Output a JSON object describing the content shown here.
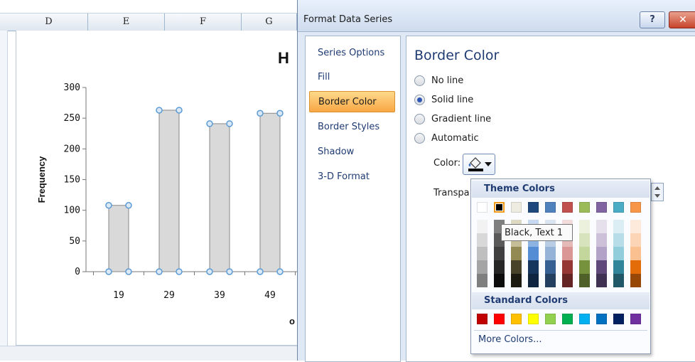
{
  "excel": {
    "columns": [
      "D",
      "E",
      "F",
      "G"
    ],
    "chart_title_partial": "H",
    "xaxis_partial": "o"
  },
  "chart_data": {
    "type": "bar",
    "categories": [
      "19",
      "29",
      "39",
      "49"
    ],
    "values": [
      108,
      263,
      241,
      258
    ],
    "title": "H",
    "xlabel": "o",
    "ylabel": "Frequency",
    "ylim": [
      0,
      300
    ],
    "yticks": [
      0,
      50,
      100,
      150,
      200,
      250,
      300
    ],
    "grid": false,
    "colors": {
      "bar_fill": "#d9d9d9",
      "bar_stroke": "#888888",
      "marker": "#5b9bd5"
    }
  },
  "dialog": {
    "title": "Format Data Series",
    "help_label": "?",
    "close_label": "✕",
    "nav": [
      {
        "label": "Series Options"
      },
      {
        "label": "Fill"
      },
      {
        "label": "Border Color"
      },
      {
        "label": "Border Styles"
      },
      {
        "label": "Shadow"
      },
      {
        "label": "3-D Format"
      }
    ],
    "active_nav": "Border Color",
    "section_title": "Border Color",
    "options": [
      {
        "label": "No line",
        "selected": false
      },
      {
        "label": "Solid line",
        "selected": true
      },
      {
        "label": "Gradient line",
        "selected": false
      },
      {
        "label": "Automatic",
        "selected": false
      }
    ],
    "color_label": "Color:",
    "transparency_label": "Transpa",
    "icons": {
      "color_button": "paint-bucket-icon",
      "dropdown": "chevron-down-icon"
    }
  },
  "palette": {
    "theme_header": "Theme Colors",
    "standard_header": "Standard Colors",
    "more_colors": "More Colors...",
    "tooltip": "Black, Text 1",
    "theme_top": [
      "#ffffff",
      "#000000",
      "#eeece1",
      "#1f497d",
      "#4f81bd",
      "#c0504d",
      "#9bbb59",
      "#8064a2",
      "#4bacc6",
      "#f79646"
    ],
    "theme_shades": [
      [
        "#f2f2f2",
        "#d8d8d8",
        "#bfbfbf",
        "#a5a5a5",
        "#7f7f7f"
      ],
      [
        "#7f7f7f",
        "#595959",
        "#3f3f3f",
        "#262626",
        "#0c0c0c"
      ],
      [
        "#ddd9c3",
        "#c4bd97",
        "#938953",
        "#494429",
        "#1d1b10"
      ],
      [
        "#c6d9f0",
        "#8db3e2",
        "#548dd4",
        "#17365d",
        "#0f243e"
      ],
      [
        "#dbe5f1",
        "#b8cce4",
        "#95b3d7",
        "#366092",
        "#244061"
      ],
      [
        "#f2dcdb",
        "#e5b9b7",
        "#d99694",
        "#953734",
        "#632423"
      ],
      [
        "#ebf1dd",
        "#d7e3bc",
        "#c3d69b",
        "#76923c",
        "#4f6128"
      ],
      [
        "#e5e0ec",
        "#ccc1d9",
        "#b2a2c7",
        "#5f497a",
        "#3f3151"
      ],
      [
        "#dbeef3",
        "#b7dde8",
        "#92cddc",
        "#31859b",
        "#205867"
      ],
      [
        "#fdeada",
        "#fbd5b5",
        "#fac08f",
        "#e36c09",
        "#974806"
      ]
    ],
    "standard": [
      "#c00000",
      "#ff0000",
      "#ffc000",
      "#ffff00",
      "#92d050",
      "#00b050",
      "#00b0f0",
      "#0070c0",
      "#002060",
      "#7030a0"
    ],
    "selected_color": "#000000"
  }
}
